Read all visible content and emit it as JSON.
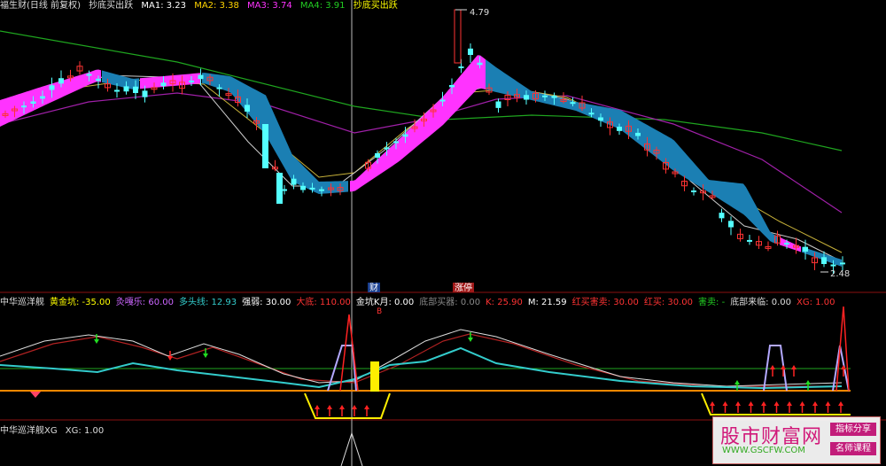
{
  "header_main": {
    "title": "福生财(日线 前复权)",
    "indicator": "抄底买出跃",
    "ma": [
      {
        "label": "MA1: 3.23",
        "color": "#ffffff"
      },
      {
        "label": "MA2: 3.38",
        "color": "#ffd400"
      },
      {
        "label": "MA3: 3.74",
        "color": "#ff33ff"
      },
      {
        "label": "MA4: 3.91",
        "color": "#22cc22"
      }
    ],
    "extra": "抄底买出跃"
  },
  "header_sub1": {
    "items": [
      {
        "label": "中华巡洋舰",
        "color": "#dddddd"
      },
      {
        "label": "黄金坑: -35.00",
        "color": "#ffff00"
      },
      {
        "label": "灸嘎乐: 60.00",
        "color": "#cc66ff"
      },
      {
        "label": "多头线: 12.93",
        "color": "#33cccc"
      },
      {
        "label": "强弱: 30.00",
        "color": "#ffffff"
      },
      {
        "label": "大底: 110.00",
        "color": "#ff3333"
      },
      {
        "label": "金坑K月: 0.00",
        "color": "#ffffff"
      },
      {
        "label": "底部买器: 0.00",
        "color": "#888888"
      },
      {
        "label": "K: 25.90",
        "color": "#ff3333"
      },
      {
        "label": "M: 21.59",
        "color": "#ffffff"
      },
      {
        "label": "红买害卖: 30.00",
        "color": "#ff3333"
      },
      {
        "label": "红买: 30.00",
        "color": "#ff3333"
      },
      {
        "label": "害卖: -",
        "color": "#22cc22"
      },
      {
        "label": "底部来临: 0.00",
        "color": "#dddddd"
      },
      {
        "label": "XG: 1.00",
        "color": "#ff3333"
      }
    ]
  },
  "header_sub2": {
    "label": "中华巡洋舰XG",
    "value": "XG: 1.00"
  },
  "markers": {
    "cai": "财",
    "zhangting": "涨停",
    "b": "B"
  },
  "watermark": {
    "title": "股市财富网",
    "url": "WWW.GSCFW.COM",
    "tag1": "指标分享",
    "tag2": "名师课程"
  },
  "chart_data": {
    "type": "candlestick",
    "price_labels": {
      "high": "4.79",
      "low": "2.48"
    },
    "high_value": 4.79,
    "low_value": 2.48,
    "colors": {
      "up": "#ff3333",
      "down": "#54ffff",
      "band_up": "#ff33ff",
      "band_down": "#1b7fb3"
    }
  }
}
